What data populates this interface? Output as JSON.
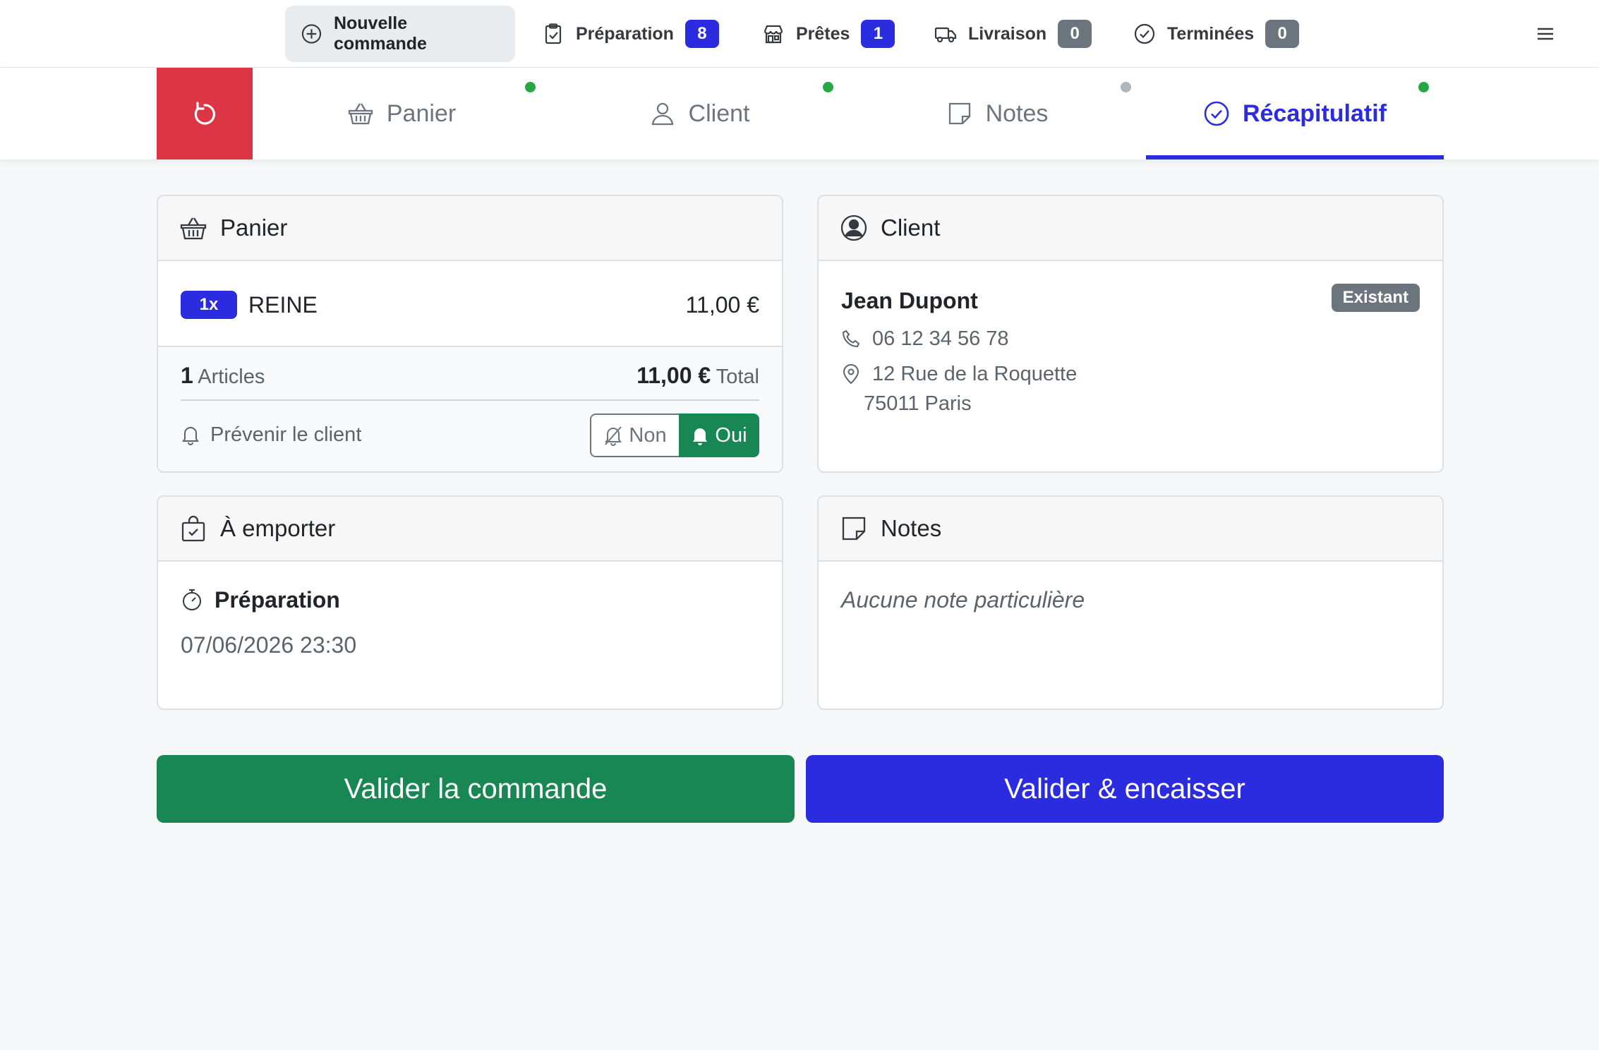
{
  "nav": {
    "new_order": "Nouvelle commande",
    "items": [
      {
        "label": "Préparation",
        "count": "8"
      },
      {
        "label": "Prêtes",
        "count": "1"
      },
      {
        "label": "Livraison",
        "count": "0"
      },
      {
        "label": "Terminées",
        "count": "0"
      }
    ]
  },
  "steps": [
    {
      "label": "Panier",
      "status": "complete"
    },
    {
      "label": "Client",
      "status": "complete"
    },
    {
      "label": "Notes",
      "status": "empty"
    },
    {
      "label": "Récapitulatif",
      "status": "complete",
      "active": true
    }
  ],
  "cart": {
    "title": "Panier",
    "items": [
      {
        "qty": "1x",
        "name": "REINE",
        "price": "11,00 €"
      }
    ],
    "count": "1",
    "count_label": "Articles",
    "total": "11,00 €",
    "total_label": "Total",
    "notify_label": "Prévenir le client",
    "notify_no": "Non",
    "notify_yes": "Oui",
    "notify_selected": "Oui"
  },
  "client": {
    "title": "Client",
    "name": "Jean Dupont",
    "status": "Existant",
    "phone": "06 12 34 56 78",
    "address_line1": "12 Rue de la Roquette",
    "address_line2": "75011 Paris"
  },
  "order_type": {
    "title": "À emporter",
    "prep_label": "Préparation",
    "prep_time": "07/06/2026 23:30"
  },
  "notes": {
    "title": "Notes",
    "text": "Aucune note particulière"
  },
  "actions": {
    "validate": "Valider la commande",
    "validate_pay": "Valider & encaisser"
  },
  "colors": {
    "primary": "#2b2be0",
    "success": "#198754",
    "danger": "#dc3545",
    "secondary": "#6c757d",
    "dot_complete": "#28a745",
    "dot_empty": "#adb5bd"
  }
}
